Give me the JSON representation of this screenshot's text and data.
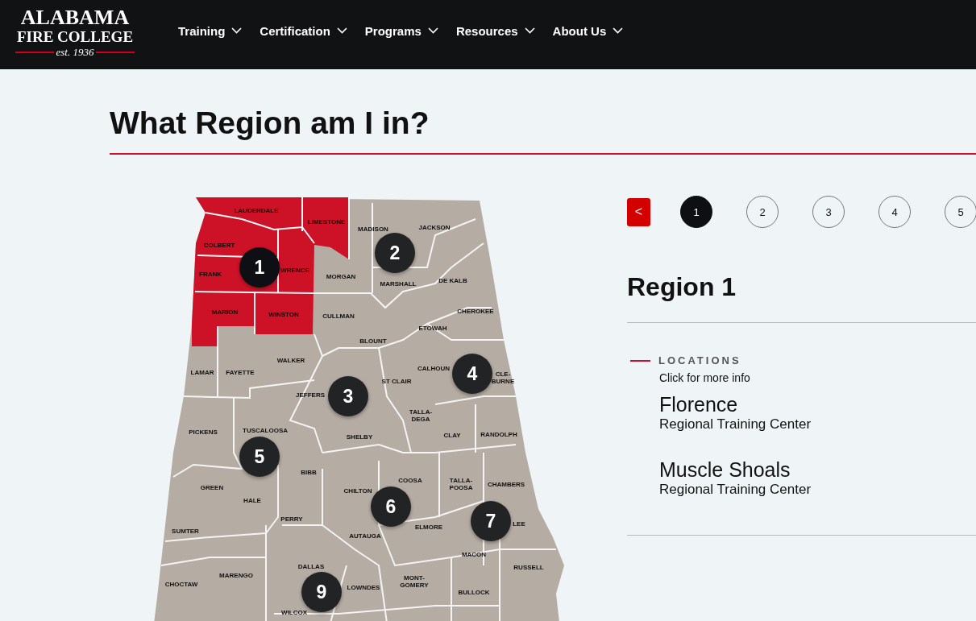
{
  "header": {
    "logo": {
      "line_1": "ALABAMA",
      "line_2": "FIRE COLLEGE",
      "tagline": "est. 1936"
    },
    "nav": [
      {
        "label": "Training"
      },
      {
        "label": "Certification"
      },
      {
        "label": "Programs"
      },
      {
        "label": "Resources"
      },
      {
        "label": "About Us"
      }
    ]
  },
  "page_title": "What Region am I in?",
  "map": {
    "counties": [
      {
        "name": "LAUDERDALE",
        "highlighted": true
      },
      {
        "name": "LIMESTONE",
        "highlighted": true
      },
      {
        "name": "MADISON",
        "highlighted": false
      },
      {
        "name": "JACKSON",
        "highlighted": false
      },
      {
        "name": "COLBERT",
        "highlighted": true
      },
      {
        "name": "FRANK",
        "highlighted": true
      },
      {
        "name": "WRENCE",
        "highlighted": true
      },
      {
        "name": "MORGAN",
        "highlighted": false
      },
      {
        "name": "MARSHALL",
        "highlighted": false
      },
      {
        "name": "DE KALB",
        "highlighted": false
      },
      {
        "name": "MARION",
        "highlighted": true
      },
      {
        "name": "WINSTON",
        "highlighted": true
      },
      {
        "name": "CULLMAN",
        "highlighted": false
      },
      {
        "name": "CHEROKEE",
        "highlighted": false
      },
      {
        "name": "ETOWAH",
        "highlighted": false
      },
      {
        "name": "BLOUNT",
        "highlighted": false
      },
      {
        "name": "LAMAR",
        "highlighted": false
      },
      {
        "name": "FAYETTE",
        "highlighted": false
      },
      {
        "name": "WALKER",
        "highlighted": false
      },
      {
        "name": "CALHOUN",
        "highlighted": false
      },
      {
        "name": "ST CLAIR",
        "highlighted": false
      },
      {
        "name": "CLE-\nBURNE",
        "highlighted": false
      },
      {
        "name": "JEFFERS",
        "highlighted": false
      },
      {
        "name": "TALLA-\nDEGA",
        "highlighted": false
      },
      {
        "name": "PICKENS",
        "highlighted": false
      },
      {
        "name": "TUSCALOOSA",
        "highlighted": false
      },
      {
        "name": "SHELBY",
        "highlighted": false
      },
      {
        "name": "CLAY",
        "highlighted": false
      },
      {
        "name": "RANDOLPH",
        "highlighted": false
      },
      {
        "name": "BIBB",
        "highlighted": false
      },
      {
        "name": "GREEN",
        "highlighted": false
      },
      {
        "name": "HALE",
        "highlighted": false
      },
      {
        "name": "CHILTON",
        "highlighted": false
      },
      {
        "name": "COOSA",
        "highlighted": false
      },
      {
        "name": "TALLA-\nPOOSA",
        "highlighted": false
      },
      {
        "name": "CHAMBERS",
        "highlighted": false
      },
      {
        "name": "PERRY",
        "highlighted": false
      },
      {
        "name": "SUMTER",
        "highlighted": false
      },
      {
        "name": "AUTAUGA",
        "highlighted": false
      },
      {
        "name": "ELMORE",
        "highlighted": false
      },
      {
        "name": "LEE",
        "highlighted": false
      },
      {
        "name": "MACON",
        "highlighted": false
      },
      {
        "name": "RUSSELL",
        "highlighted": false
      },
      {
        "name": "CHOCTAW",
        "highlighted": false
      },
      {
        "name": "MARENGO",
        "highlighted": false
      },
      {
        "name": "DALLAS",
        "highlighted": false
      },
      {
        "name": "LOWNDES",
        "highlighted": false
      },
      {
        "name": "MONT-\nGOMERY",
        "highlighted": false
      },
      {
        "name": "BULLOCK",
        "highlighted": false
      },
      {
        "name": "WILCOX",
        "highlighted": false
      }
    ],
    "region_markers": [
      "1",
      "2",
      "3",
      "4",
      "5",
      "6",
      "7",
      "9"
    ]
  },
  "pager": {
    "prev": "<",
    "pages": [
      {
        "label": "1",
        "selected": true
      },
      {
        "label": "2",
        "selected": false
      },
      {
        "label": "3",
        "selected": false
      },
      {
        "label": "4",
        "selected": false
      },
      {
        "label": "5",
        "selected": false
      }
    ]
  },
  "region": {
    "title": "Region 1",
    "section_label": "LOCATIONS",
    "hint": "Click for more info",
    "locations": [
      {
        "name": "Florence",
        "type": "Regional Training Center"
      },
      {
        "name": "Muscle Shoals",
        "type": "Regional Training Center"
      }
    ]
  }
}
